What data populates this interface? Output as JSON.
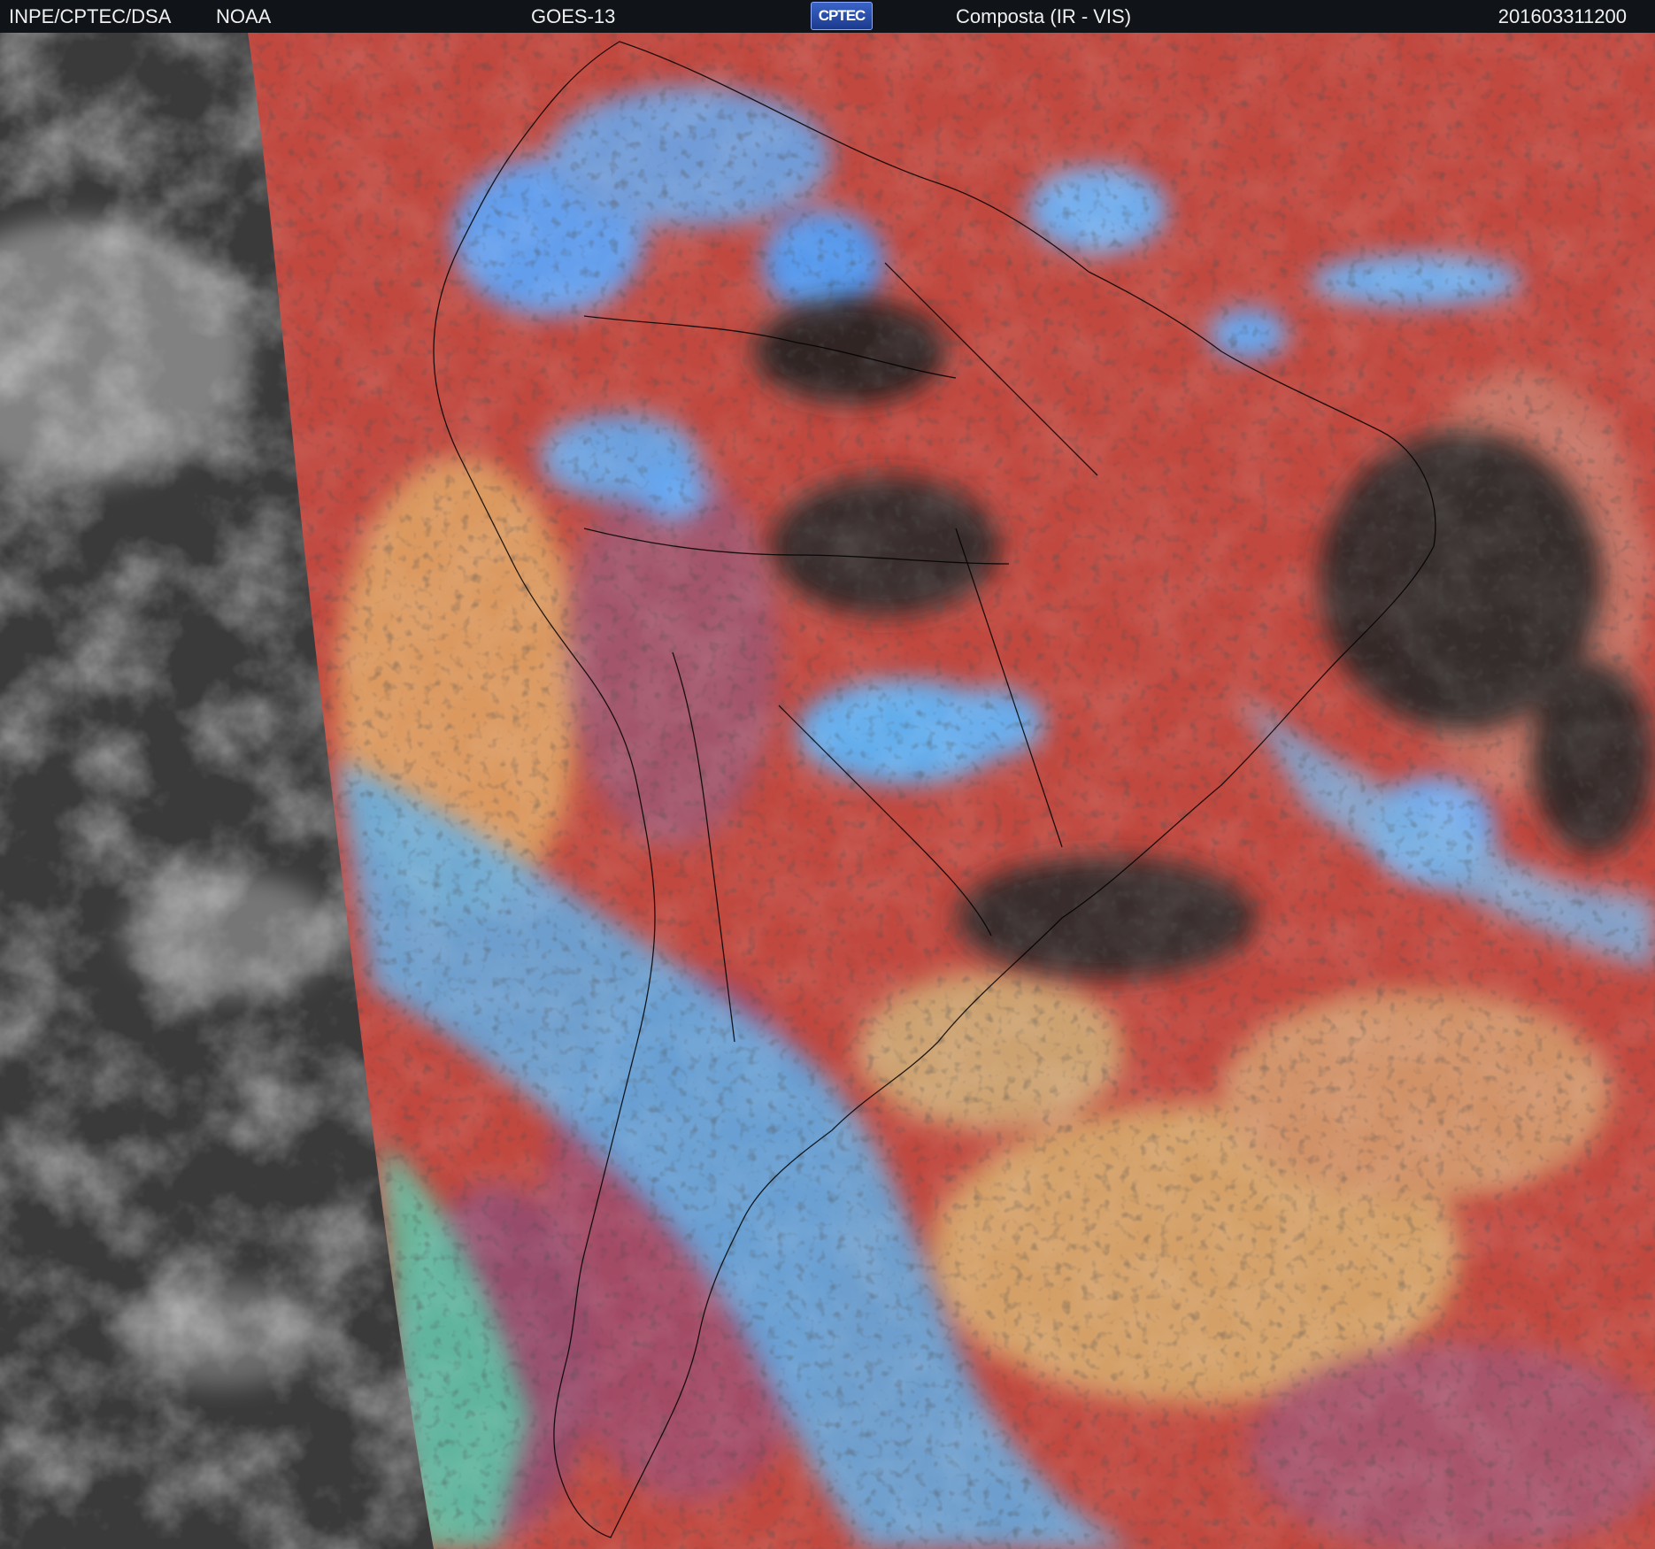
{
  "header": {
    "organization": "INPE/CPTEC/DSA",
    "agency": "NOAA",
    "satellite": "GOES-13",
    "logo_text": "CPTEC",
    "product": "Composta (IR - VIS)",
    "timestamp": "201603311200"
  },
  "colors": {
    "header_background": "#101419",
    "night_side": "#3a3a3a",
    "clear_surface": "#c0483f",
    "high_cloud": "#5ab4ff",
    "low_cloud": "#e0b060",
    "boundaries": "#000000"
  }
}
